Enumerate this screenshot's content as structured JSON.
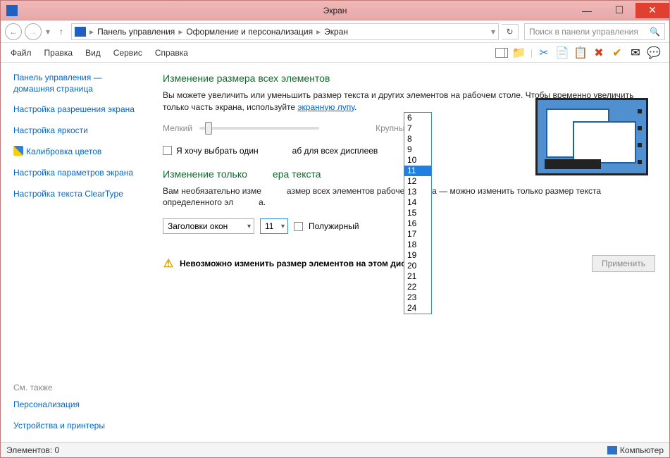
{
  "window": {
    "title": "Экран"
  },
  "breadcrumb": {
    "root": "Панель управления",
    "mid": "Оформление и персонализация",
    "leaf": "Экран"
  },
  "search": {
    "placeholder": "Поиск в панели управления"
  },
  "menu": {
    "file": "Файл",
    "edit": "Правка",
    "view": "Вид",
    "service": "Сервис",
    "help": "Справка"
  },
  "sidebar": {
    "home": "Панель управления — домашняя страница",
    "resolution": "Настройка разрешения экрана",
    "brightness": "Настройка яркости",
    "calibrate": "Калибровка цветов",
    "params": "Настройка параметров экрана",
    "cleartype": "Настройка текста ClearType",
    "seealso": "См. также",
    "personalization": "Персонализация",
    "devices": "Устройства и принтеры"
  },
  "main": {
    "h1": "Изменение размера всех элементов",
    "p1a": "Вы можете увеличить или уменьшить размер текста и других элементов на рабочем столе. Чтобы временно увеличить только часть экрана, используйте ",
    "p1link": "экранную лупу",
    "p1b": ".",
    "slider_min": "Мелкий",
    "slider_max": "Крупный",
    "checkbox_pre": "Я хочу выбрать один",
    "checkbox_post": "аб для всех дисплеев",
    "h2": "Изменение только",
    "h2_post": "ера текста",
    "p2a": "Вам необязательно изме",
    "p2b": "азмер всех элементов рабочего стола — можно изменить только размер текста определенного эл",
    "p2c": "а.",
    "select_item": "Заголовки окон",
    "select_size": "11",
    "bold": "Полужирный",
    "warning": "Невозможно изменить размер элементов на этом дисплее.",
    "apply": "Применить"
  },
  "dropdown": {
    "options": [
      "6",
      "7",
      "8",
      "9",
      "10",
      "11",
      "12",
      "13",
      "14",
      "15",
      "16",
      "17",
      "18",
      "19",
      "20",
      "21",
      "22",
      "23",
      "24"
    ],
    "selected": "11"
  },
  "status": {
    "items": "Элементов: 0",
    "computer": "Компьютер"
  }
}
